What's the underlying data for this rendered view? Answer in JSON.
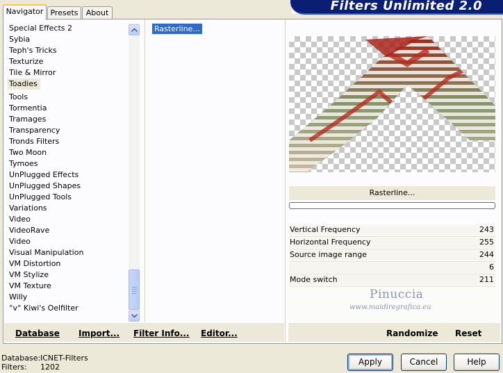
{
  "header": {
    "title": "Filters Unlimited 2.0"
  },
  "tabs": [
    {
      "label": "Navigator",
      "active": true
    },
    {
      "label": "Presets",
      "active": false
    },
    {
      "label": "About",
      "active": false
    }
  ],
  "categories": [
    "Special Effects 2",
    "Sybia",
    "Teph's Tricks",
    "Texturize",
    "Tile & Mirror",
    "Toadies",
    "Tools",
    "Tormentia",
    "Tramages",
    "Transparency",
    "Tronds Filters",
    "Two Moon",
    "Tymoes",
    "UnPlugged Effects",
    "UnPlugged Shapes",
    "UnPlugged Tools",
    "Variations",
    "Video",
    "VideoRave",
    "Video",
    "Visual Manipulation",
    "VM Distortion",
    "VM Stylize",
    "VM Texture",
    "Willy",
    "°v° Kiwi's Oelfilter"
  ],
  "selected_category": "Toadies",
  "filters": {
    "selected": "Rasterline..."
  },
  "preview": {
    "filter_name": "Rasterline..."
  },
  "params": [
    {
      "label": "Vertical Frequency",
      "value": "243"
    },
    {
      "label": "Horizontal Frequency",
      "value": "255"
    },
    {
      "label": "Source image range",
      "value": "244"
    },
    {
      "label": "",
      "value": "6"
    },
    {
      "label": "Mode switch",
      "value": "211"
    }
  ],
  "watermark": {
    "line1": "Pinuccia",
    "line2": "www.maidiregrafica.eu"
  },
  "actions": {
    "database": "Database",
    "import": "Import...",
    "filter_info": "Filter Info...",
    "editor": "Editor...",
    "randomize": "Randomize",
    "reset": "Reset"
  },
  "status": {
    "database_label": "Database:",
    "database_value": "ICNET-Filters",
    "filters_label": "Filters:",
    "filters_value": "1202"
  },
  "buttons": {
    "apply": "Apply",
    "cancel": "Cancel",
    "help": "Help"
  },
  "colors": {
    "banner": "#0a1f73",
    "selection": "#316ac5",
    "preview_red": "#a8231a",
    "preview_green": "#9aa97c"
  }
}
